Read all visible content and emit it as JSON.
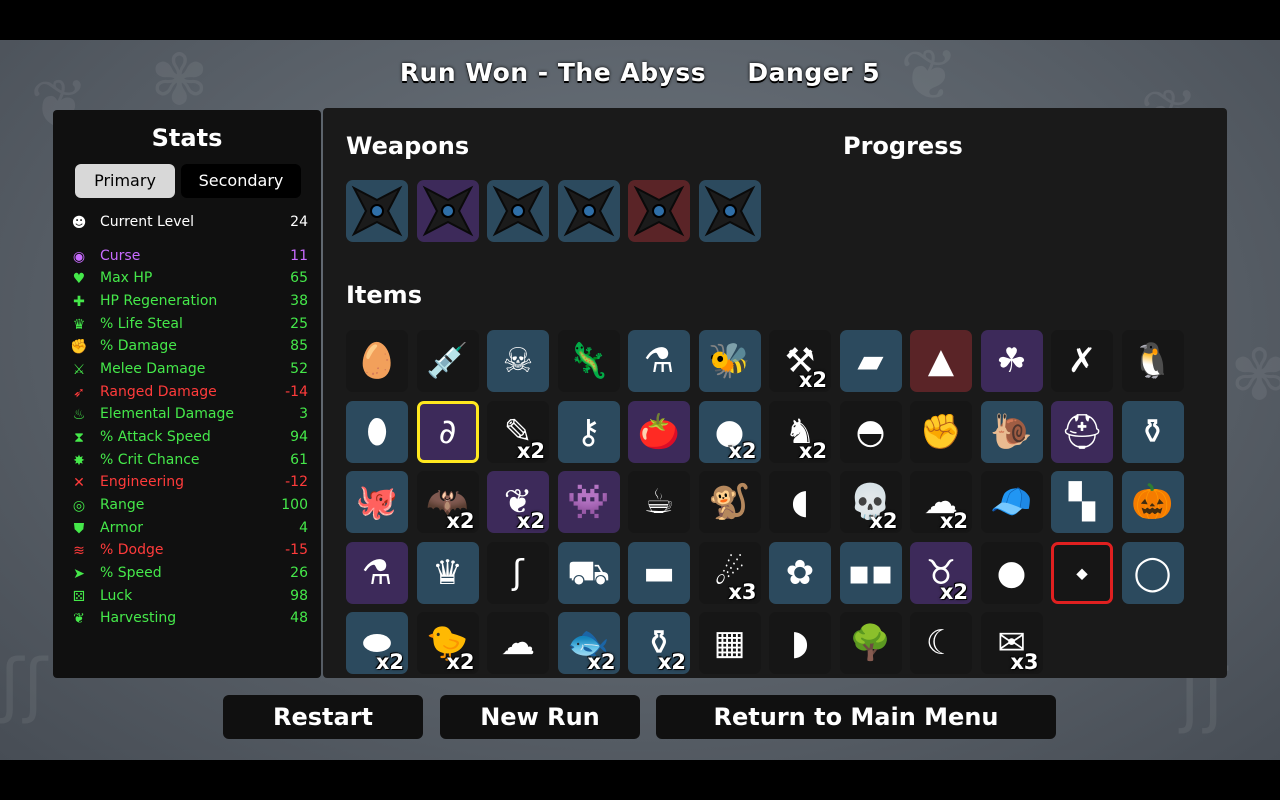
{
  "header": {
    "run_result": "Run Won - The Abyss",
    "danger": "Danger 5"
  },
  "colors": {
    "common": "#2c4a5e",
    "rare": "#3d2a5a",
    "legendary": "#5a2427",
    "tier1": "#161616",
    "positive": "#45e84a",
    "negative": "#ff3b3b",
    "neutral": "#ffffff",
    "curse": "#c86bff",
    "selected_border": "#ffe81f",
    "locked_border": "#e02020"
  },
  "stats": {
    "title": "Stats",
    "tabs": {
      "primary": "Primary",
      "secondary": "Secondary"
    },
    "rows": [
      {
        "icon": "level-icon",
        "glyph": "☻",
        "name": "Current Level",
        "value": "24",
        "tone": "neutral"
      },
      {
        "icon": "curse-eye-icon",
        "glyph": "◉",
        "name": "Curse",
        "value": "11",
        "tone": "curse"
      },
      {
        "icon": "heart-icon",
        "glyph": "♥",
        "name": "Max HP",
        "value": "65",
        "tone": "positive"
      },
      {
        "icon": "hp-regen-icon",
        "glyph": "✚",
        "name": "HP Regeneration",
        "value": "38",
        "tone": "positive"
      },
      {
        "icon": "life-steal-icon",
        "glyph": "♛",
        "name": "% Life Steal",
        "value": "25",
        "tone": "positive"
      },
      {
        "icon": "damage-fist-icon",
        "glyph": "✊",
        "name": "% Damage",
        "value": "85",
        "tone": "positive"
      },
      {
        "icon": "sword-icon",
        "glyph": "⚔",
        "name": "Melee Damage",
        "value": "52",
        "tone": "positive"
      },
      {
        "icon": "bow-icon",
        "glyph": "➶",
        "name": "Ranged Damage",
        "value": "-14",
        "tone": "negative"
      },
      {
        "icon": "flame-icon",
        "glyph": "♨",
        "name": "Elemental Damage",
        "value": "3",
        "tone": "positive"
      },
      {
        "icon": "hourglass-icon",
        "glyph": "⧗",
        "name": "% Attack Speed",
        "value": "94",
        "tone": "positive"
      },
      {
        "icon": "crit-icon",
        "glyph": "✸",
        "name": "% Crit Chance",
        "value": "61",
        "tone": "positive"
      },
      {
        "icon": "wrench-icon",
        "glyph": "✕",
        "name": "Engineering",
        "value": "-12",
        "tone": "negative"
      },
      {
        "icon": "range-icon",
        "glyph": "◎",
        "name": "Range",
        "value": "100",
        "tone": "positive"
      },
      {
        "icon": "shield-icon",
        "glyph": "⛊",
        "name": "Armor",
        "value": "4",
        "tone": "positive"
      },
      {
        "icon": "dodge-icon",
        "glyph": "≋",
        "name": "% Dodge",
        "value": "-15",
        "tone": "negative"
      },
      {
        "icon": "boot-icon",
        "glyph": "➤",
        "name": "% Speed",
        "value": "26",
        "tone": "positive"
      },
      {
        "icon": "dice-icon",
        "glyph": "⚄",
        "name": "Luck",
        "value": "98",
        "tone": "positive"
      },
      {
        "icon": "wheat-icon",
        "glyph": "❦",
        "name": "Harvesting",
        "value": "48",
        "tone": "positive"
      }
    ]
  },
  "weapons": {
    "title": "Weapons",
    "slots": [
      {
        "icon": "shuriken-icon",
        "tier": "common"
      },
      {
        "icon": "shuriken-icon",
        "tier": "rare"
      },
      {
        "icon": "shuriken-icon",
        "tier": "common"
      },
      {
        "icon": "shuriken-icon",
        "tier": "common"
      },
      {
        "icon": "shuriken-icon",
        "tier": "legendary"
      },
      {
        "icon": "shuriken-icon",
        "tier": "common"
      }
    ]
  },
  "progress": {
    "title": "Progress"
  },
  "items": {
    "title": "Items",
    "slots": [
      {
        "icon": "egg-icon",
        "glyph": "🥚",
        "tier": "tier1",
        "count": ""
      },
      {
        "icon": "syringe-icon",
        "glyph": "💉",
        "tier": "tier1",
        "count": ""
      },
      {
        "icon": "bandit-icon",
        "glyph": "☠",
        "tier": "common",
        "count": ""
      },
      {
        "icon": "lizard-icon",
        "glyph": "🦎",
        "tier": "tier1",
        "count": ""
      },
      {
        "icon": "potion-icon",
        "glyph": "⚗",
        "tier": "common",
        "count": ""
      },
      {
        "icon": "wasp-icon",
        "glyph": "🐝",
        "tier": "common",
        "count": ""
      },
      {
        "icon": "scythe-icon",
        "glyph": "⚒",
        "tier": "tier1",
        "count": "x2"
      },
      {
        "icon": "plank-icon",
        "glyph": "▰",
        "tier": "common",
        "count": ""
      },
      {
        "icon": "gnome-icon",
        "glyph": "▲",
        "tier": "legendary",
        "count": ""
      },
      {
        "icon": "clover-icon",
        "glyph": "☘",
        "tier": "rare",
        "count": ""
      },
      {
        "icon": "barbed-wire-icon",
        "glyph": "✗",
        "tier": "tier1",
        "count": ""
      },
      {
        "icon": "penguin-icon",
        "glyph": "🐧",
        "tier": "tier1",
        "count": ""
      },
      {
        "icon": "bullet-icon",
        "glyph": "⬮",
        "tier": "common",
        "count": ""
      },
      {
        "icon": "tentacle-icon",
        "glyph": "∂",
        "tier": "rare",
        "count": "",
        "selected": true
      },
      {
        "icon": "medical-syringe-icon",
        "glyph": "✎",
        "tier": "tier1",
        "count": "x2"
      },
      {
        "icon": "padlock-key-icon",
        "glyph": "⚷",
        "tier": "common",
        "count": ""
      },
      {
        "icon": "tomato-icon",
        "glyph": "🍅",
        "tier": "rare",
        "count": ""
      },
      {
        "icon": "moon-orb-icon",
        "glyph": "●",
        "tier": "common",
        "count": "x2"
      },
      {
        "icon": "voodoo-doll-icon",
        "glyph": "♞",
        "tier": "tier1",
        "count": "x2"
      },
      {
        "icon": "beanie-icon",
        "glyph": "◓",
        "tier": "tier1",
        "count": ""
      },
      {
        "icon": "boxing-glove-icon",
        "glyph": "✊",
        "tier": "tier1",
        "count": ""
      },
      {
        "icon": "snail-icon",
        "glyph": "🐌",
        "tier": "common",
        "count": ""
      },
      {
        "icon": "knight-helmet-icon",
        "glyph": "⛑",
        "tier": "rare",
        "count": ""
      },
      {
        "icon": "jar-icon",
        "glyph": "⚱",
        "tier": "common",
        "count": ""
      },
      {
        "icon": "octopus-icon",
        "glyph": "🐙",
        "tier": "common",
        "count": ""
      },
      {
        "icon": "bat-icon",
        "glyph": "🦇",
        "tier": "tier1",
        "count": "x2"
      },
      {
        "icon": "wings-icon",
        "glyph": "❦",
        "tier": "rare",
        "count": "x2"
      },
      {
        "icon": "alien-icon",
        "glyph": "👾",
        "tier": "rare",
        "count": ""
      },
      {
        "icon": "coffee-cup-icon",
        "glyph": "☕",
        "tier": "tier1",
        "count": ""
      },
      {
        "icon": "monkey-icon",
        "glyph": "🐒",
        "tier": "tier1",
        "count": ""
      },
      {
        "icon": "fang-icon",
        "glyph": "◖",
        "tier": "tier1",
        "count": ""
      },
      {
        "icon": "skull-icon",
        "glyph": "💀",
        "tier": "tier1",
        "count": "x2"
      },
      {
        "icon": "bandage-icon",
        "glyph": "☁",
        "tier": "tier1",
        "count": "x2"
      },
      {
        "icon": "propeller-hat-icon",
        "glyph": "🧢",
        "tier": "tier1",
        "count": ""
      },
      {
        "icon": "scarf-icon",
        "glyph": "▚",
        "tier": "common",
        "count": ""
      },
      {
        "icon": "pumpkin-icon",
        "glyph": "🎃",
        "tier": "common",
        "count": ""
      },
      {
        "icon": "mortar-icon",
        "glyph": "⚗",
        "tier": "rare",
        "count": ""
      },
      {
        "icon": "crown-of-thorns-icon",
        "glyph": "♛",
        "tier": "common",
        "count": ""
      },
      {
        "icon": "tongue-icon",
        "glyph": "ʃ",
        "tier": "tier1",
        "count": ""
      },
      {
        "icon": "wheelbarrow-icon",
        "glyph": "⛟",
        "tier": "common",
        "count": ""
      },
      {
        "icon": "black-stone-icon",
        "glyph": "▬",
        "tier": "common",
        "count": ""
      },
      {
        "icon": "spirit-icon",
        "glyph": "☄",
        "tier": "tier1",
        "count": "x3"
      },
      {
        "icon": "dead-bug-icon",
        "glyph": "✿",
        "tier": "common",
        "count": ""
      },
      {
        "icon": "glasses-icon",
        "glyph": "▪▪",
        "tier": "common",
        "count": ""
      },
      {
        "icon": "crab-claws-icon",
        "glyph": "♉",
        "tier": "rare",
        "count": "x2"
      },
      {
        "icon": "poop-bag-icon",
        "glyph": "●",
        "tier": "tier1",
        "count": ""
      },
      {
        "icon": "jetpack-icon",
        "glyph": "⬩",
        "tier": "tier1",
        "count": "",
        "locked": true
      },
      {
        "icon": "black-belt-icon",
        "glyph": "◯",
        "tier": "common",
        "count": ""
      },
      {
        "icon": "fish-fin-icon",
        "glyph": "⬬",
        "tier": "common",
        "count": "x2"
      },
      {
        "icon": "rubber-duck-icon",
        "glyph": "🐤",
        "tier": "tier1",
        "count": "x2"
      },
      {
        "icon": "ghost-mask-icon",
        "glyph": "☁",
        "tier": "tier1",
        "count": ""
      },
      {
        "icon": "fish-icon",
        "glyph": "🐟",
        "tier": "common",
        "count": "x2"
      },
      {
        "icon": "bottle-icon",
        "glyph": "⚱",
        "tier": "common",
        "count": "x2"
      },
      {
        "icon": "plaid-shirt-icon",
        "glyph": "▦",
        "tier": "tier1",
        "count": ""
      },
      {
        "icon": "whistle-icon",
        "glyph": "◗",
        "tier": "tier1",
        "count": ""
      },
      {
        "icon": "tree-icon",
        "glyph": "🌳",
        "tier": "tier1",
        "count": ""
      },
      {
        "icon": "sickle-icon",
        "glyph": "☾",
        "tier": "tier1",
        "count": ""
      },
      {
        "icon": "treasure-map-icon",
        "glyph": "✉",
        "tier": "tier1",
        "count": "x3"
      }
    ]
  },
  "buttons": {
    "restart": "Restart",
    "new_run": "New Run",
    "main_menu": "Return to Main Menu"
  }
}
